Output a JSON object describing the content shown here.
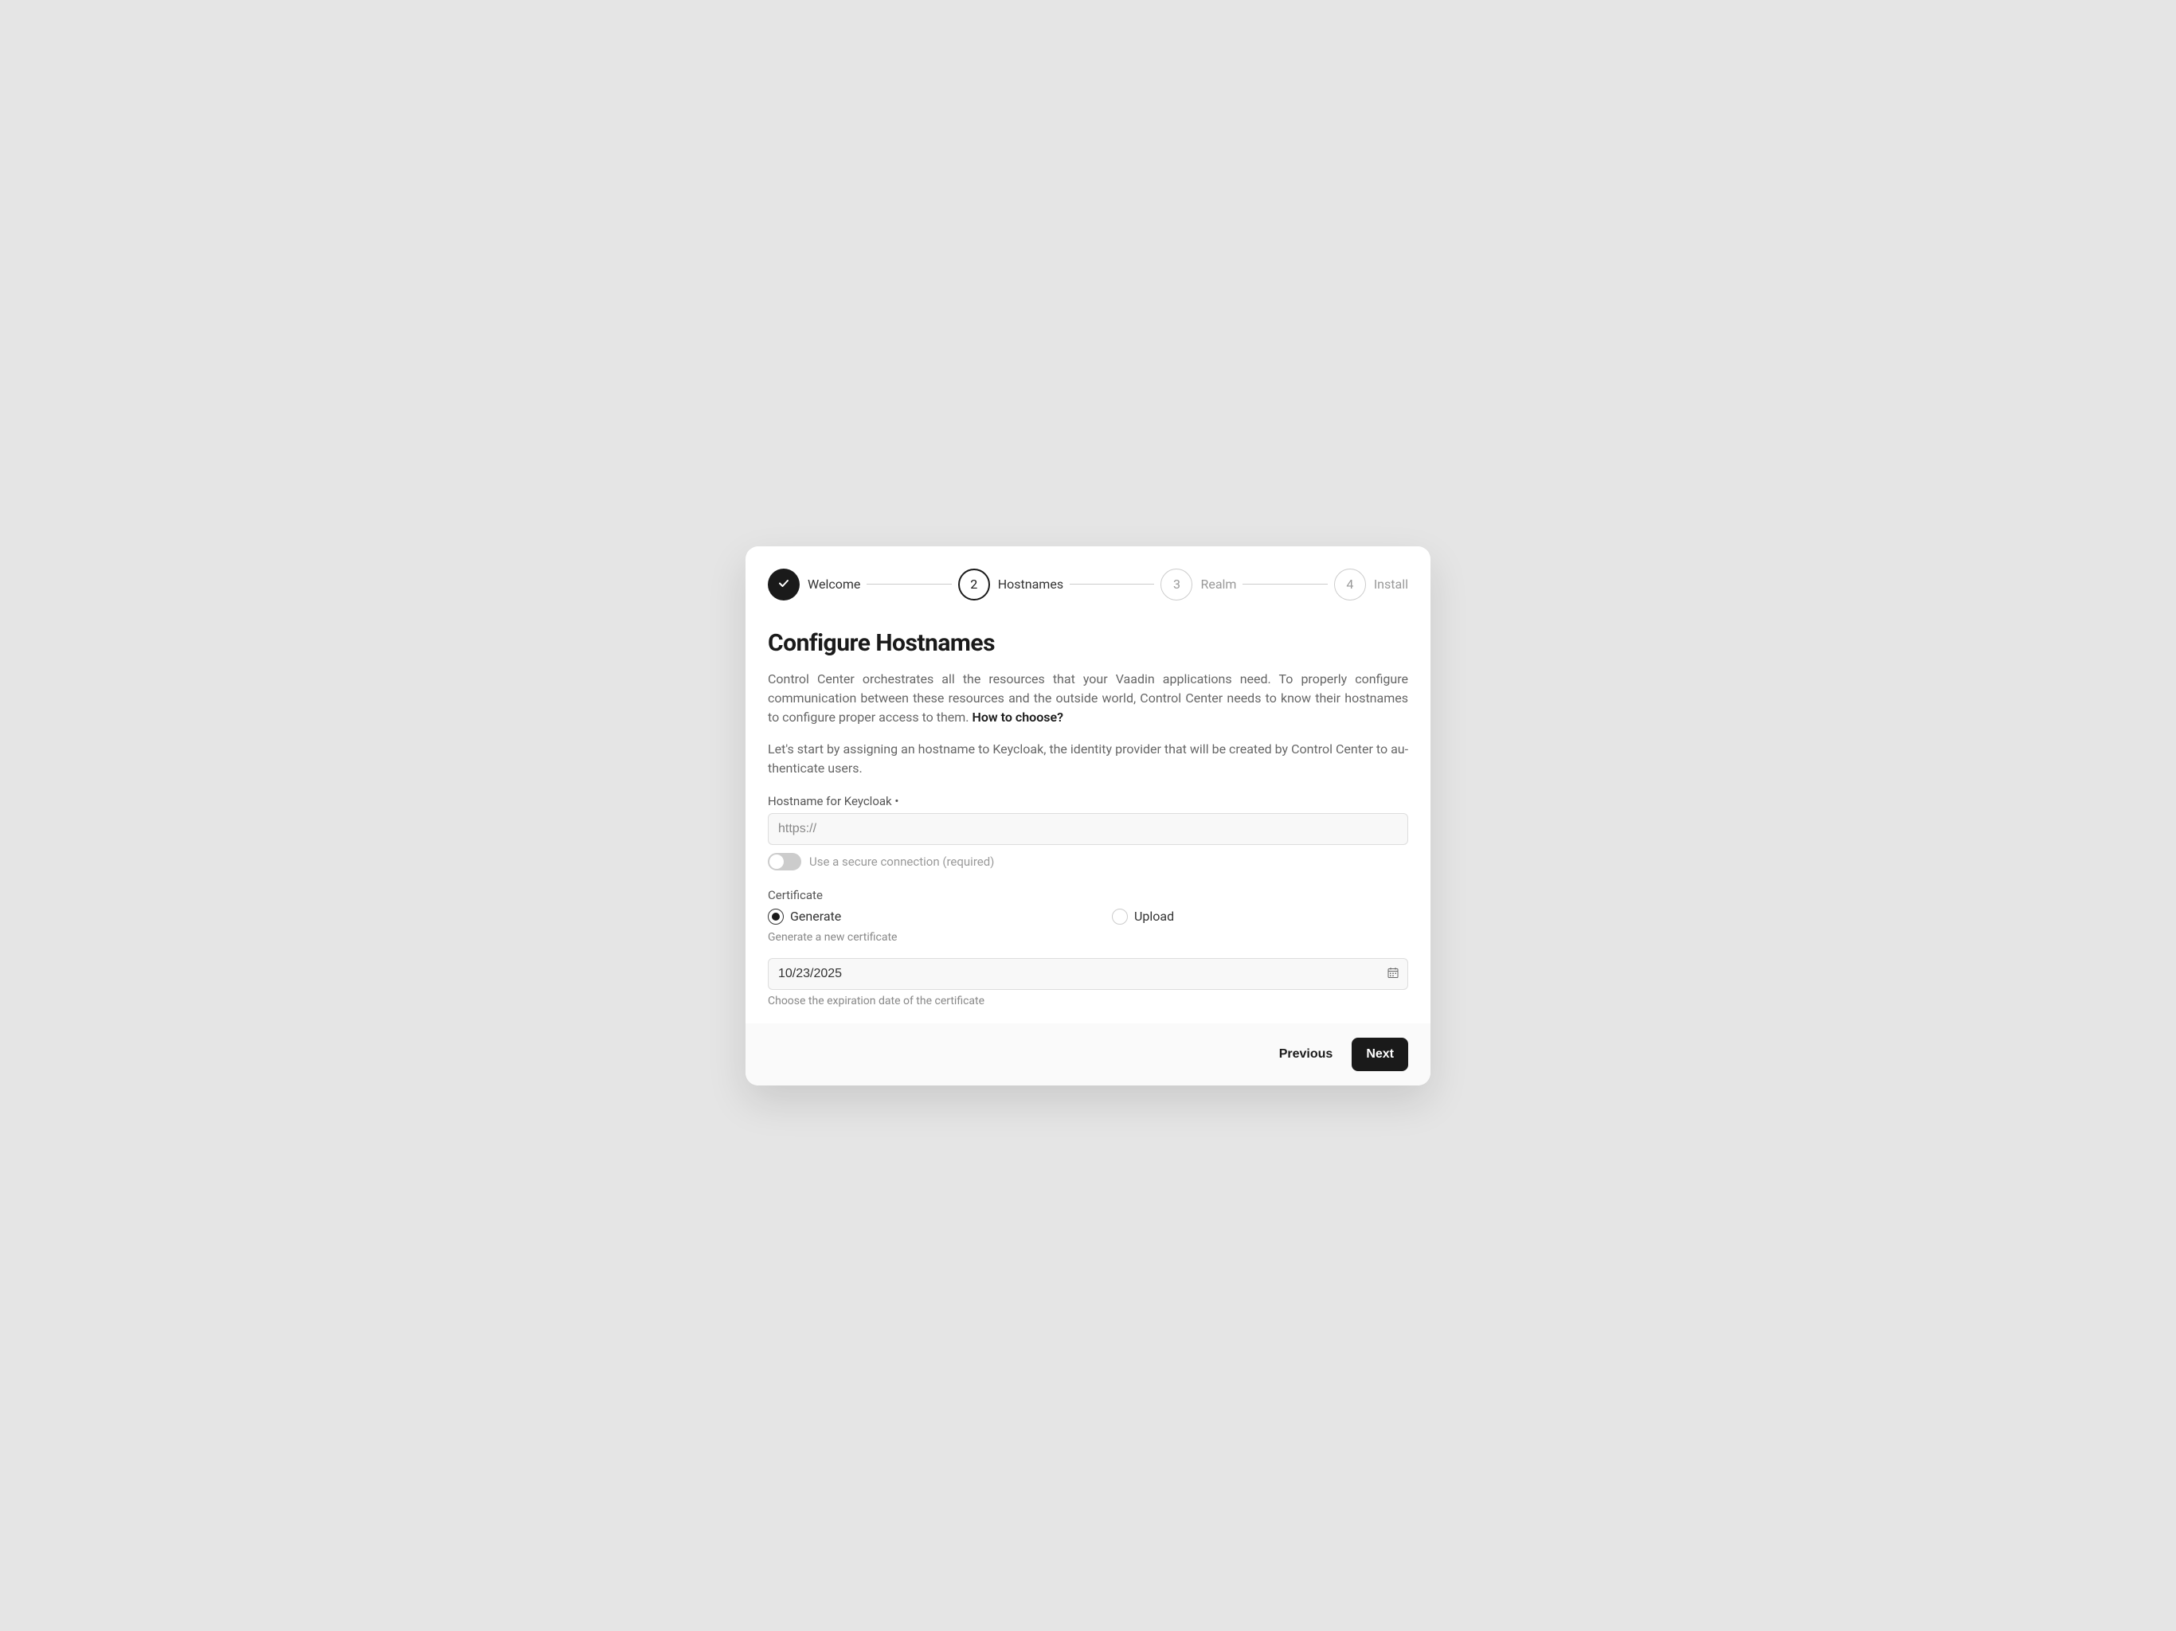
{
  "stepper": {
    "steps": [
      {
        "label": "Welcome",
        "state": "completed"
      },
      {
        "label": "Hostnames",
        "state": "active",
        "num": "2"
      },
      {
        "label": "Realm",
        "state": "pending",
        "num": "3"
      },
      {
        "label": "Install",
        "state": "pending",
        "num": "4"
      }
    ]
  },
  "heading": "Configure Hostnames",
  "description_prefix": "Control Center orchestrates all the resources that your Vaadin applications need. To properly configure communica­tion between these resources and the outside world, Control Center needs to know their hostnames to configure proper access to them.  ",
  "how_to_choose": "How to choose?",
  "subdescription": "Let's start by assigning an hostname to Keycloak, the identity provider that will be created by Control Center to au­thenticate users.",
  "hostname": {
    "label": "Hostname for Keycloak •",
    "placeholder": "https://",
    "value": ""
  },
  "secure_toggle": {
    "label": "Use a secure connection (required)",
    "on": false
  },
  "certificate": {
    "group_label": "Certificate",
    "options": {
      "generate": "Generate",
      "upload": "Upload"
    },
    "selected": "generate",
    "helper": "Generate a new certificate"
  },
  "expiry": {
    "value": "10/23/2025",
    "helper": "Choose the expiration date of the certificate"
  },
  "footer": {
    "previous": "Previous",
    "next": "Next"
  }
}
